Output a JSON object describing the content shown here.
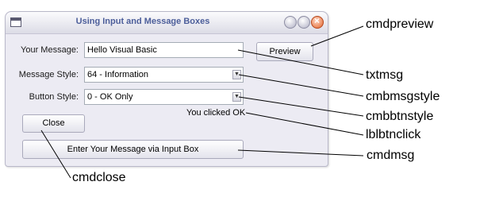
{
  "window": {
    "title": "Using Input and Message Boxes",
    "controls": [
      "minimize-icon",
      "maximize-icon",
      "close-icon"
    ]
  },
  "form": {
    "message_label": "Your Message:",
    "message_value": "Hello Visual Basic",
    "preview_button": "Preview",
    "style_label": "Message Style:",
    "style_value": "64 - Information",
    "button_style_label": "Button Style:",
    "button_style_value": "0 - OK Only",
    "close_button": "Close",
    "result_text": "You clicked OK",
    "input_button": "Enter Your Message via Input Box"
  },
  "callouts": {
    "cmdpreview": "cmdpreview",
    "txtmsg": "txtmsg",
    "cmbmsgstyle": "cmbmsgstyle",
    "cmbbtnstyle": "cmbbtnstyle",
    "lblbtnclick": "lblbtnclick",
    "cmdmsg": "cmdmsg",
    "cmdclose": "cmdclose"
  },
  "icons": {
    "dropdown": "chevron-down-icon",
    "app": "form-window-icon"
  },
  "colors": {
    "title_text": "#4c5e9a",
    "window_bg": "#ecebf3",
    "close_button": "#e2652b"
  }
}
